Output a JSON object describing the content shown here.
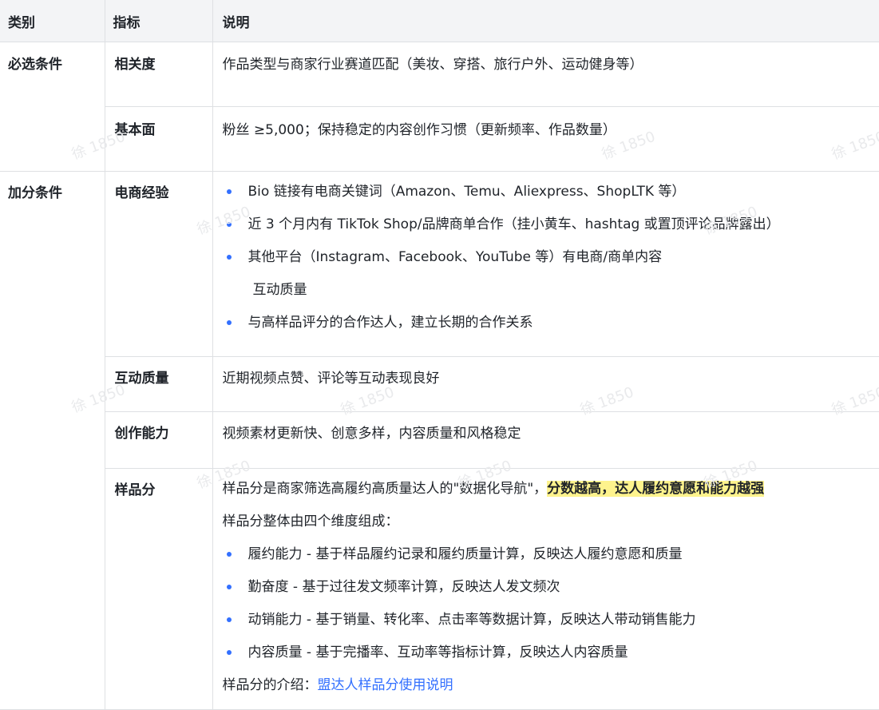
{
  "header": {
    "col1": "类别",
    "col2": "指标",
    "col3": "说明"
  },
  "rows": {
    "relevance": {
      "category": "必选条件",
      "indicator": "相关度",
      "desc": "作品类型与商家行业赛道匹配（美妆、穿搭、旅行户外、运动健身等）"
    },
    "basics": {
      "indicator": "基本面",
      "desc": "粉丝 ≥5,000；保持稳定的内容创作习惯（更新频率、作品数量）"
    },
    "ecommerce": {
      "category": "加分条件",
      "indicator": "电商经验",
      "items": [
        "Bio 链接有电商关键词（Amazon、Temu、Aliexpress、ShopLTK 等）",
        "近 3 个月内有 TikTok Shop/品牌商单合作（挂小黄车、hashtag 或置顶评论品牌露出）",
        "其他平台（Instagram、Facebook、YouTube 等）有电商/商单内容"
      ],
      "extra_line": "互动质量",
      "last_item": "与高样品评分的合作达人，建立长期的合作关系"
    },
    "engagement": {
      "indicator": "互动质量",
      "desc": "近期视频点赞、评论等互动表现良好"
    },
    "creativity": {
      "indicator": "创作能力",
      "desc": "视频素材更新快、创意多样，内容质量和风格稳定"
    },
    "sample_score": {
      "indicator": "样品分",
      "intro_prefix": "样品分是商家筛选高履约高质量达人的\"数据化导航\"，",
      "intro_highlight": "分数越高，达人履约意愿和能力越强",
      "dims_title": "样品分整体由四个维度组成：",
      "dims": [
        "履约能力 - 基于样品履约记录和履约质量计算，反映达人履约意愿和质量",
        "勤奋度 - 基于过往发文频率计算，反映达人发文频次",
        "动销能力 - 基于销量、转化率、点击率等数据计算，反映达人带动销售能力",
        "内容质量 - 基于完播率、互动率等指标计算，反映达人内容质量"
      ],
      "footer_prefix": "样品分的介绍：",
      "footer_link": "盟达人样品分使用说明"
    }
  },
  "watermark": "徐 1850",
  "colors": {
    "bullet": "#3370ff",
    "link": "#3370ff",
    "highlight": "#fef38d",
    "header_bg": "#f3f4f6",
    "border": "#dee0e3"
  }
}
